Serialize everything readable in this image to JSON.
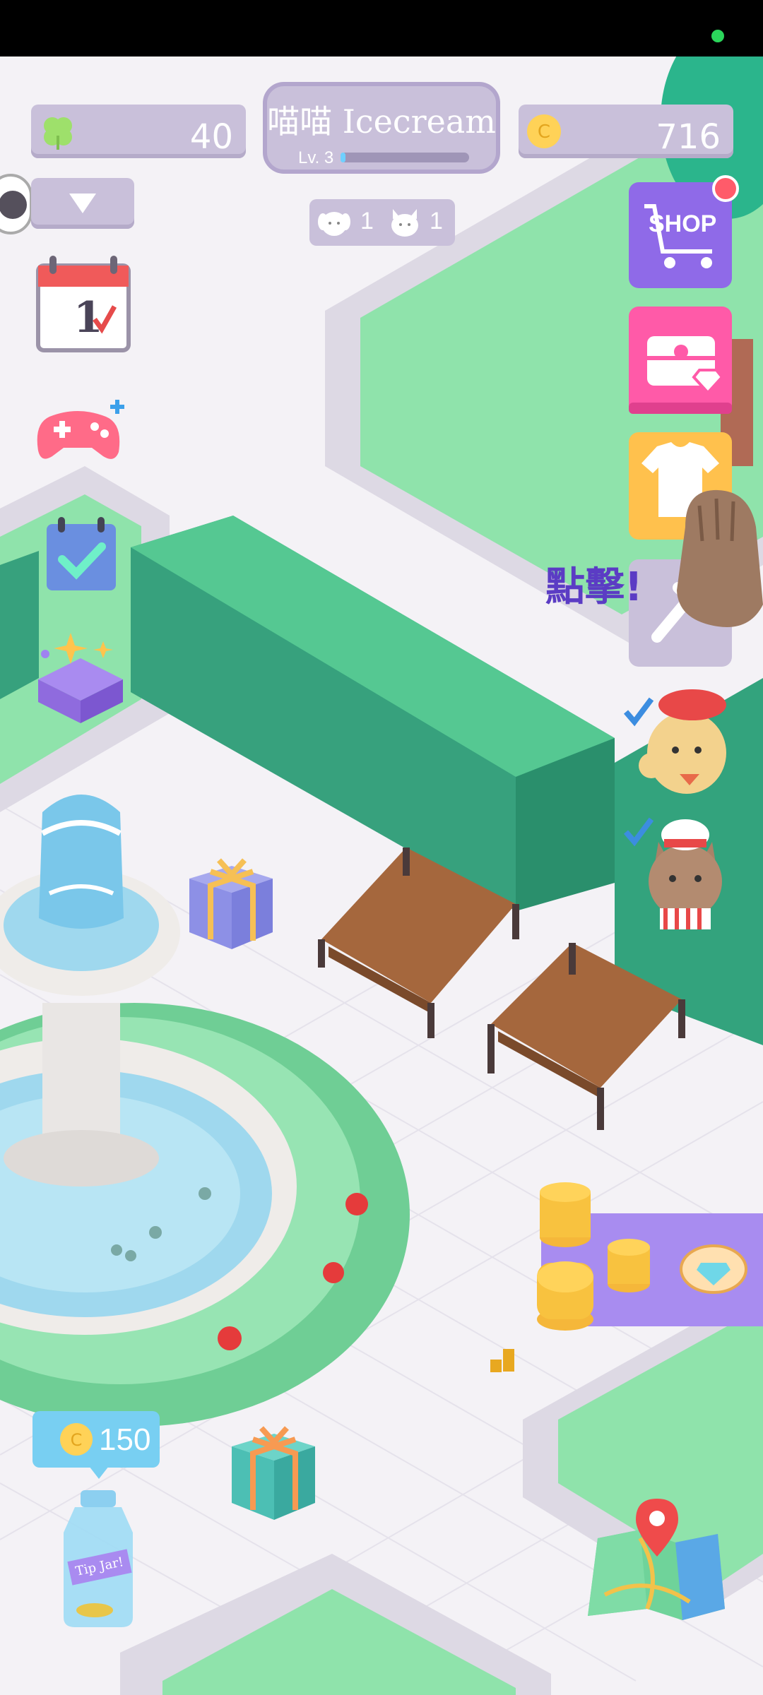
{
  "hud": {
    "clover_count": "40",
    "coin_count": "716",
    "shop_name": "喵喵 Icecream",
    "level": "Lv. 3",
    "xp_progress": 0.04,
    "dog_count": "1",
    "cat_count": "1"
  },
  "right_menu": {
    "shop_label": "SHOP",
    "tap_hint": "點擊!"
  },
  "tip_jar": {
    "amount": "150",
    "jar_label": "Tip Jar!"
  },
  "colors": {
    "hud_purple": "#c9c0da",
    "grass": "#8fe3ab",
    "hedge": "#2f9e7a",
    "shop_button": "#8f6ae8",
    "gift_button": "#ff5aa8",
    "shirt_button": "#ffc14d"
  },
  "icons": [
    "clover-icon",
    "coin-icon",
    "dropdown-arrow-icon",
    "calendar-icon",
    "gamepad-icon",
    "checklist-icon",
    "mystery-box-icon",
    "shop-cart-icon",
    "treasure-chest-icon",
    "shirt-icon",
    "tools-icon",
    "paw-icon",
    "dog-chef-icon",
    "cat-chef-icon",
    "map-icon",
    "gift-icon",
    "tip-jar-icon"
  ]
}
